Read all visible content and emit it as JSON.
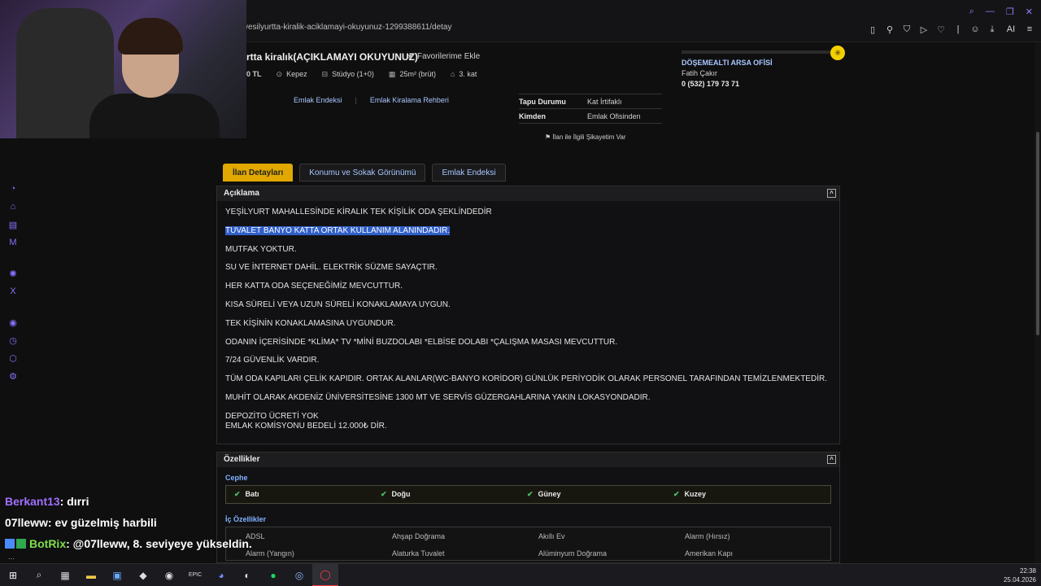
{
  "browser": {
    "url": "yesilyurtta-kiralik-aciklamayi-okuyunuz-1299388611/detay",
    "ai_label": "AI"
  },
  "listing": {
    "title": "rtta kiralık(AÇIKLAMAYI OKUYUNUZ)",
    "favorite_label": "Favorilerime Ekle",
    "price": "0 TL",
    "location": "Kepez",
    "room_type": "Stüdyo (1+0)",
    "area": "25m² (brüt)",
    "floor": "3. kat",
    "link_index": "Emlak Endeksi",
    "link_guide": "Emlak Kiralama Rehberi",
    "info_rows": [
      {
        "key": "Tapu Durumu",
        "value": "Kat İrtifaklı"
      },
      {
        "key": "Kimden",
        "value": "Emlak Ofisinden"
      }
    ],
    "complaint": "İlan ile İlgili Şikayetim Var"
  },
  "seller": {
    "office": "DÖŞEMEALTI ARSA OFİSİ",
    "name": "Fatih Çakır",
    "phone": "0 (532) 179 73 71"
  },
  "tabs": [
    {
      "label": "İlan Detayları"
    },
    {
      "label": "Konumu ve Sokak Görünümü"
    },
    {
      "label": "Emlak Endeksi"
    }
  ],
  "description": {
    "title": "Açıklama",
    "lines": [
      "YEŞİLYURT MAHALLESİNDE KİRALIK TEK KİŞİLİK ODA ŞEKLİNDEDİR",
      "TUVALET BANYO KATTA ORTAK KULLANIM ALANINDADIR.",
      "MUTFAK YOKTUR.",
      "SU VE İNTERNET DAHİL. ELEKTRİK SÜZME SAYAÇTIR.",
      "HER KATTA ODA SEÇENEĞİMİZ MEVCUTTUR.",
      "KISA SÜRELİ VEYA UZUN SÜRELİ KONAKLAMAYA UYGUN.",
      "TEK KİŞİNİN KONAKLAMASINA UYGUNDUR.",
      "ODANIN İÇERİSİNDE *KLİMA* TV *MİNİ BUZDOLABI *ELBİSE DOLABI *ÇALIŞMA MASASI MEVCUTTUR.",
      "7/24 GÜVENLİK VARDIR.",
      "TÜM ODA KAPILARI ÇELİK KAPIDIR. ORTAK ALANLAR(WC-BANYO KORİDOR) GÜNLÜK PERİYODİK OLARAK PERSONEL TARAFINDAN TEMİZLENMEKTEDİR.",
      "MUHİT OLARAK AKDENİZ ÜNİVERSİTESİNE 1300 MT VE SERVİS GÜZERGAHLARINA YAKIN LOKASYONDADIR.",
      "DEPOZİTO ÜCRETİ YOK",
      "EMLAK KOMİSYONU BEDELİ 12.000₺ DİR."
    ]
  },
  "features": {
    "title": "Özellikler",
    "cephe_title": "Cephe",
    "cephe": [
      "Batı",
      "Doğu",
      "Güney",
      "Kuzey"
    ],
    "ic_title": "İç Özellikler",
    "ic": [
      "ADSL",
      "Ahşap Doğrama",
      "Akıllı Ev",
      "Alarm (Hırsız)",
      "Alarm (Yangın)",
      "Alaturka Tuvalet",
      "Alüminyum Doğrama",
      "Amerikan Kapı"
    ]
  },
  "chat": [
    {
      "user": "Berkant13",
      "msg": ": dırri"
    },
    {
      "user": "07lleww",
      "msg": ": ev güzelmiş harbili"
    },
    {
      "user": "BotRix",
      "msg": ": @07lleww, 8. seviyeye yükseldin."
    }
  ],
  "clock": {
    "time": "22:38",
    "date": "25.04.2026"
  },
  "colors": {
    "accent": "#e0a800",
    "link": "#a9c7ff",
    "highlight": "#3060c8"
  }
}
